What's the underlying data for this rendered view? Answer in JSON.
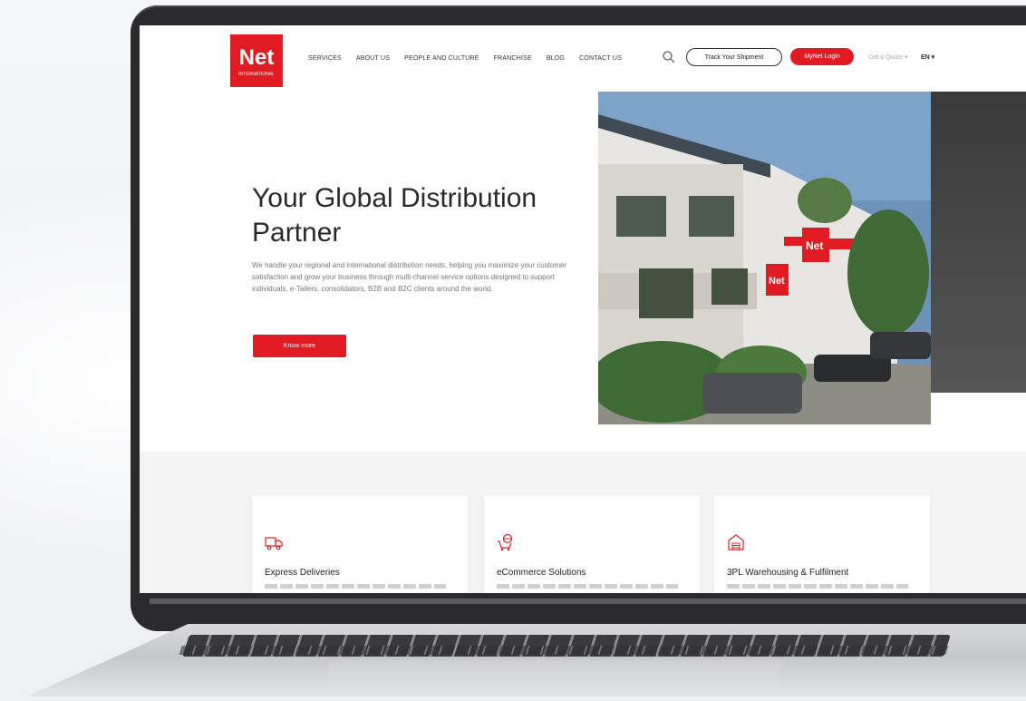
{
  "nav": {
    "logo_text": "Net",
    "logo_sub": "INTERNATIONAL",
    "links": [
      "SERVICES",
      "ABOUT US",
      "PEOPLE AND CULTURE",
      "FRANCHISE",
      "BLOG",
      "CONTACT US"
    ],
    "track_button": "Track Your Shipment",
    "login_button": "MyNet Login",
    "quote_link": "Get a Quote ▾",
    "language": "EN ▾"
  },
  "hero": {
    "title": "Your Global Distribution Partner",
    "description": "We handle your regional and international distribution needs, helping you maximize your customer satisfaction and grow your business through multi-channel service options designed to support individuals, e-Tailers, consolidators, B2B and B2C clients around the world.",
    "cta_label": "Know more",
    "building_sign": "Net"
  },
  "services": [
    {
      "title": "Express Deliveries",
      "icon": "delivery-truck-icon"
    },
    {
      "title": "eCommerce Solutions",
      "icon": "shopping-cart-globe-icon"
    },
    {
      "title": "3PL Warehousing & Fulfilment",
      "icon": "warehouse-icon"
    }
  ],
  "colors": {
    "brand_red": "#e11b22",
    "text_dark": "#2a2a2a"
  }
}
